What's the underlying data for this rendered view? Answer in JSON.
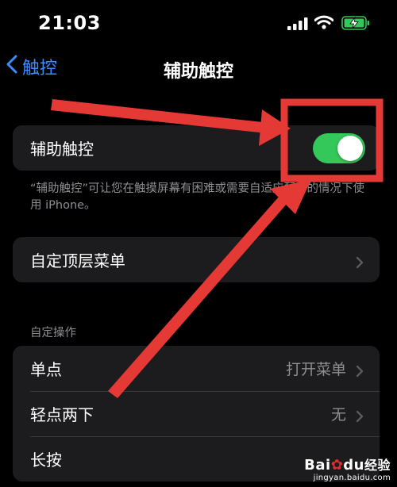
{
  "status_bar": {
    "time": "21:03",
    "icons": [
      "signal-icon",
      "wifi-icon",
      "battery-charging-icon"
    ],
    "battery_color": "#34c759"
  },
  "nav": {
    "back_label": "触控",
    "title": "辅助触控",
    "accent_color": "#3a8cff"
  },
  "assistive_touch": {
    "label": "辅助触控",
    "toggle_on": true,
    "toggle_color": "#34c759",
    "footer": "“辅助触控”可让您在触摸屏幕有困难或需要自适应配件的情况下使用 iPhone。"
  },
  "top_level_menu": {
    "label": "自定顶层菜单"
  },
  "custom_actions": {
    "header": "自定操作",
    "rows": [
      {
        "label": "单点",
        "value": "打开菜单"
      },
      {
        "label": "轻点两下",
        "value": "无"
      },
      {
        "label": "长按",
        "value": ""
      }
    ]
  },
  "annotation": {
    "color": "#e53935",
    "shapes": [
      "highlight-box",
      "arrow-from-top-left",
      "arrow-from-bottom"
    ]
  },
  "watermark": {
    "brand_left": "Bai",
    "brand_mid": "du",
    "brand_right": "经验",
    "site": "jingyan.baidu.com"
  }
}
